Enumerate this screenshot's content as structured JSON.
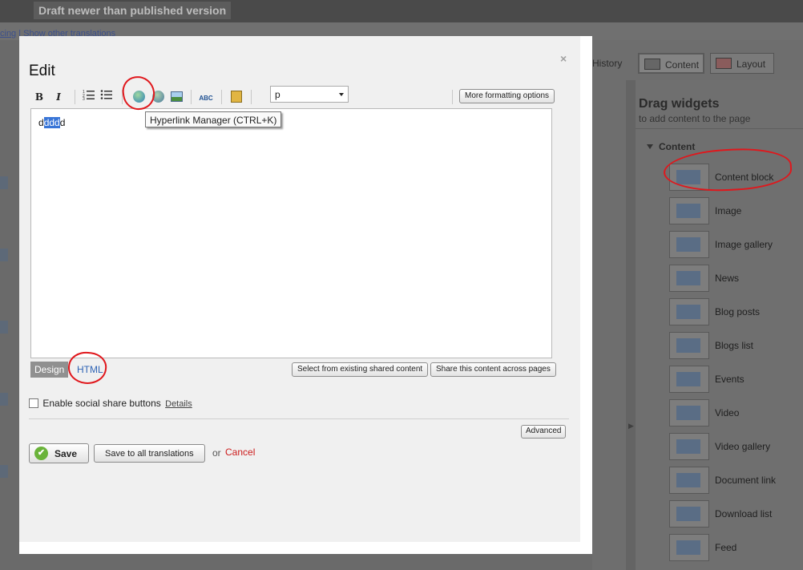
{
  "background": {
    "draft_badge": "Draft newer than published version",
    "translation_links": {
      "prefix": "cing",
      "separator": " | ",
      "show_other": "Show other translations"
    },
    "history_tab": "History",
    "view_buttons": {
      "content": "Content",
      "layout": "Layout"
    }
  },
  "widget_panel": {
    "title": "Drag widgets",
    "subtitle": "to add content to the page",
    "section": "Content",
    "widgets": [
      {
        "label": "Content block"
      },
      {
        "label": "Image"
      },
      {
        "label": "Image gallery"
      },
      {
        "label": "News"
      },
      {
        "label": "Blog posts"
      },
      {
        "label": "Blogs list"
      },
      {
        "label": "Events"
      },
      {
        "label": "Video"
      },
      {
        "label": "Video gallery"
      },
      {
        "label": "Document link"
      },
      {
        "label": "Download list"
      },
      {
        "label": "Feed"
      }
    ]
  },
  "dialog": {
    "title": "Edit",
    "close": "×",
    "toolbar": {
      "bold": "B",
      "italic": "I",
      "spellcheck_label": "ABC",
      "format_value": "p",
      "more_formatting": "More formatting options"
    },
    "tooltip": "Hyperlink Manager (CTRL+K)",
    "editor": {
      "before": "d",
      "selected": "ddd",
      "after": "d"
    },
    "modes": {
      "design": "Design",
      "html": "HTML"
    },
    "shared": {
      "select_existing": "Select from existing shared content",
      "share_across": "Share this content across pages"
    },
    "social": {
      "label": "Enable social share buttons",
      "details": "Details"
    },
    "advanced": "Advanced",
    "actions": {
      "save": "Save",
      "save_all": "Save to all translations",
      "or": "or",
      "cancel": "Cancel"
    }
  },
  "colors": {
    "annotation": "#e0171c",
    "cancel": "#cc1b1b",
    "selection": "#3875d7",
    "html_link": "#2f64b5"
  }
}
